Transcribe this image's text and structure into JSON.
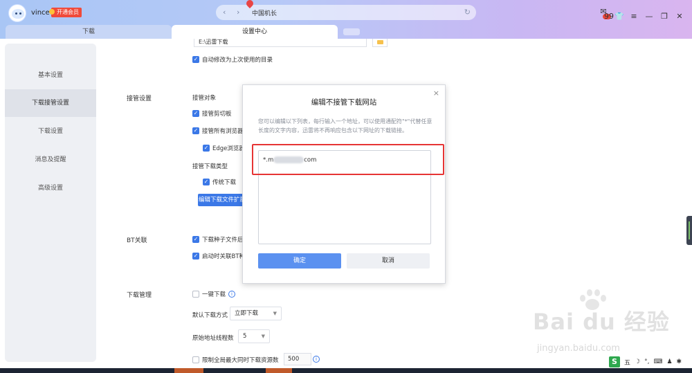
{
  "user": {
    "name": "vince",
    "vip_label": "开通会员"
  },
  "urlbar": {
    "back": "‹",
    "forward": "›",
    "text": "中国机长",
    "refresh": "↻"
  },
  "window_controls": {
    "notification_count": "99"
  },
  "tabs": [
    {
      "label": "下载"
    },
    {
      "label": "设置中心"
    }
  ],
  "sidebar": {
    "items": [
      {
        "label": "基本设置"
      },
      {
        "label": "下载接管设置"
      },
      {
        "label": "下载设置"
      },
      {
        "label": "消息及提醒"
      },
      {
        "label": "高级设置"
      }
    ]
  },
  "settings": {
    "path_value": "E:\\迅雷下载",
    "auto_modify_dir": "自动修改为上次使用的目录",
    "takeover_label": "接管设置",
    "takeover_objects": "接管对象",
    "takeover_clipboard": "接管剪切板",
    "takeover_all_browsers": "接管所有浏览器",
    "edge_browser": "Edge浏览器",
    "takeover_types": "接管下载类型",
    "traditional_download": "传统下载",
    "edit_types_button": "编辑下载文件扩展名",
    "bt_label": "BT关联",
    "bt_torrent": "下载种子文件后",
    "bt_startup": "启动时关联BT种子",
    "download_mgmt_label": "下载管理",
    "one_click": "一键下载",
    "default_mode_label": "默认下载方式",
    "default_mode_value": "立即下载",
    "threads_label": "原始地址线程数",
    "threads_value": "5",
    "limit_label": "限制全局最大同时下载资源数",
    "limit_value": "500"
  },
  "dialog": {
    "title": "编辑不接管下载网站",
    "description": "您可以编辑以下列表，每行输入一个地址，可以使用通配符\"*\"代替任意长度的文字内容，迅雷将不再响应包含以下网址的下载链接。",
    "entry_prefix": "*.m",
    "entry_suffix": "com",
    "ok_label": "确定",
    "cancel_label": "取消"
  },
  "watermark": {
    "logo": "Bai du 经验",
    "url": "jingyan.baidu.com"
  },
  "tray": {
    "ime": "S",
    "ime_text": "五"
  }
}
